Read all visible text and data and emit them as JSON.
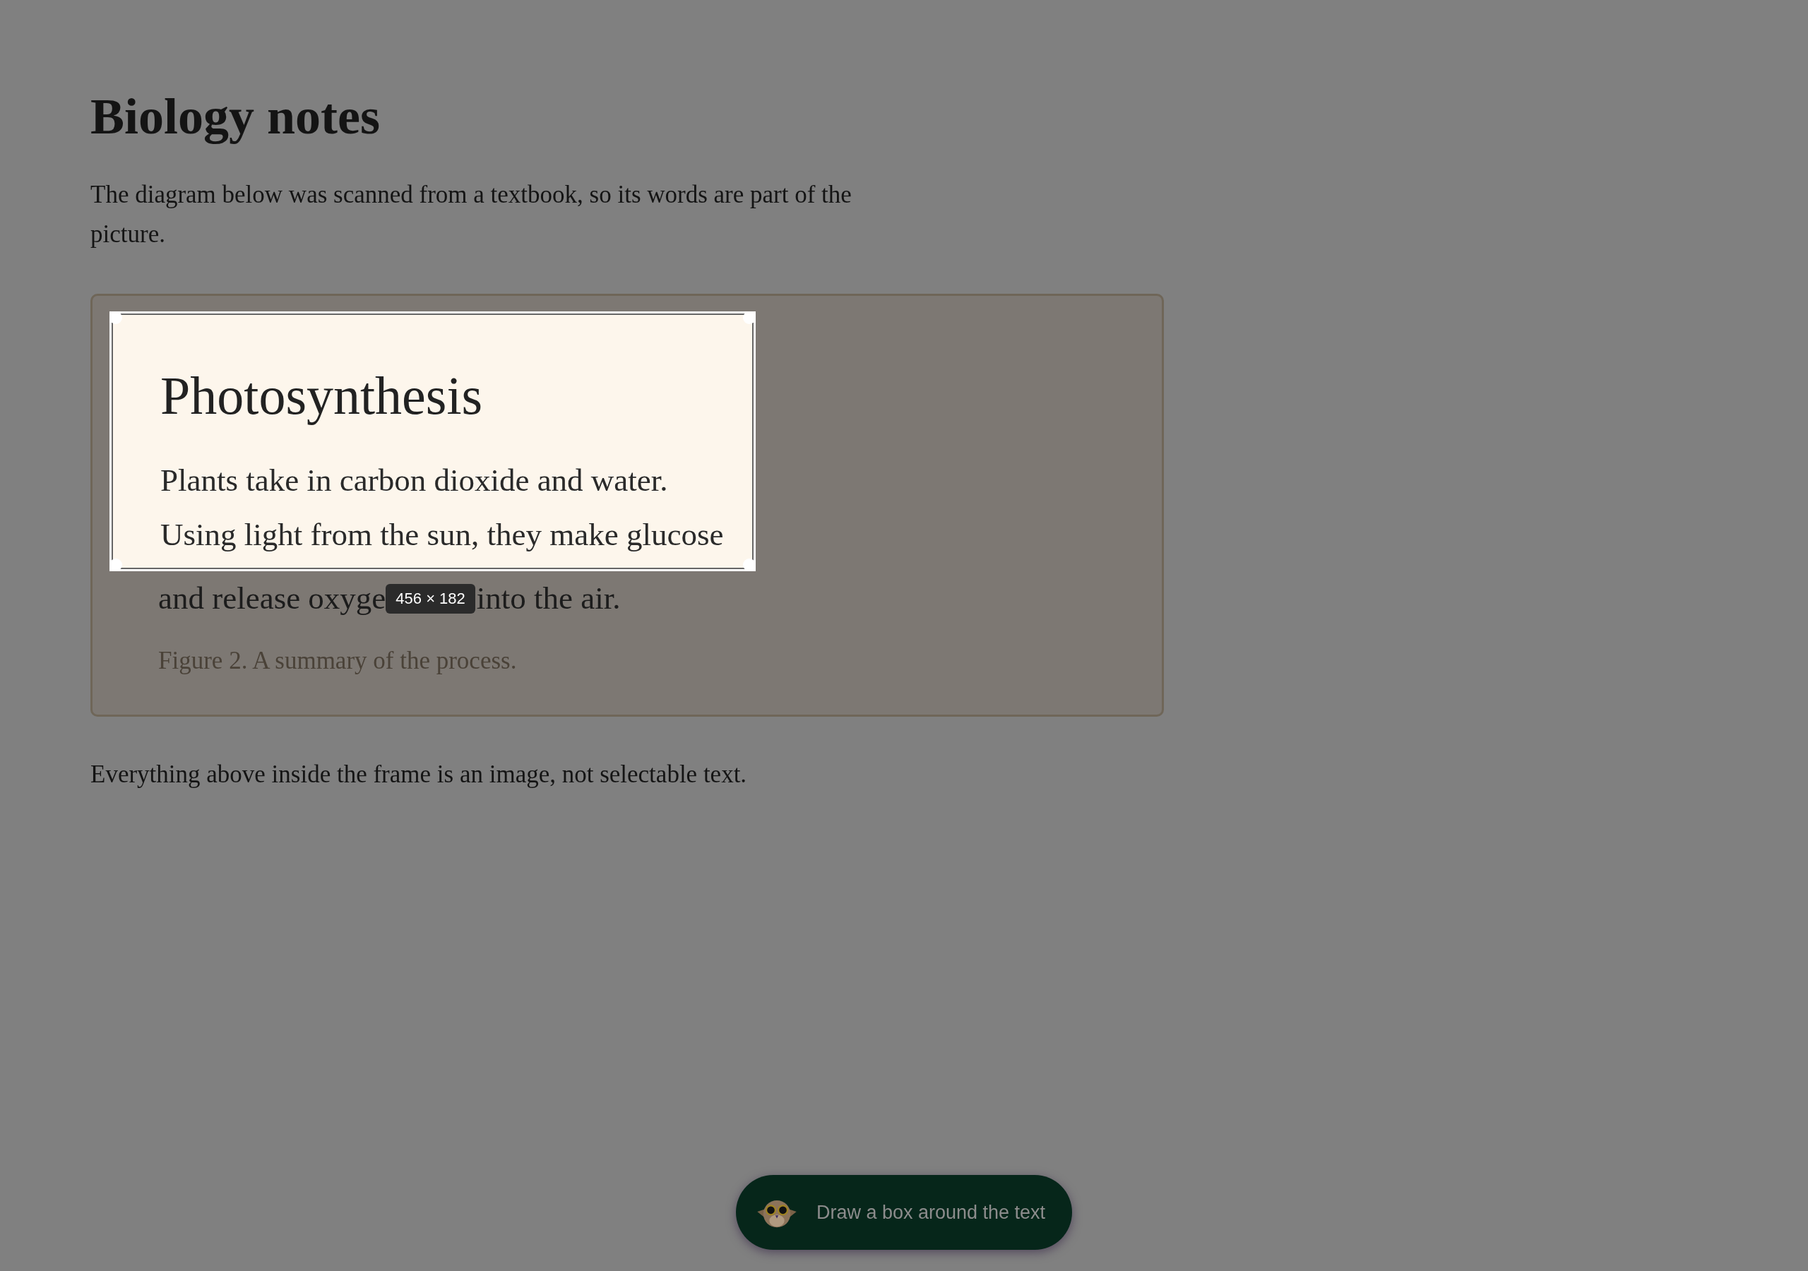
{
  "page": {
    "title": "Biology notes",
    "intro": "The diagram below was scanned from a textbook, so its words are part of the picture.",
    "figure": {
      "heading": "Photosynthesis",
      "lines": [
        "Plants take in carbon dioxide and water.",
        "Using light from the sun, they make glucose"
      ],
      "covered_line": [
        "and release oxyge",
        "into the air."
      ],
      "caption": "Figure 2. A summary of the process."
    },
    "footer_note": "Everything above inside the frame is an image, not selectable text."
  },
  "selection": {
    "size_label": "456 × 182"
  },
  "hint_pill": {
    "text": "Draw a box around the text"
  }
}
